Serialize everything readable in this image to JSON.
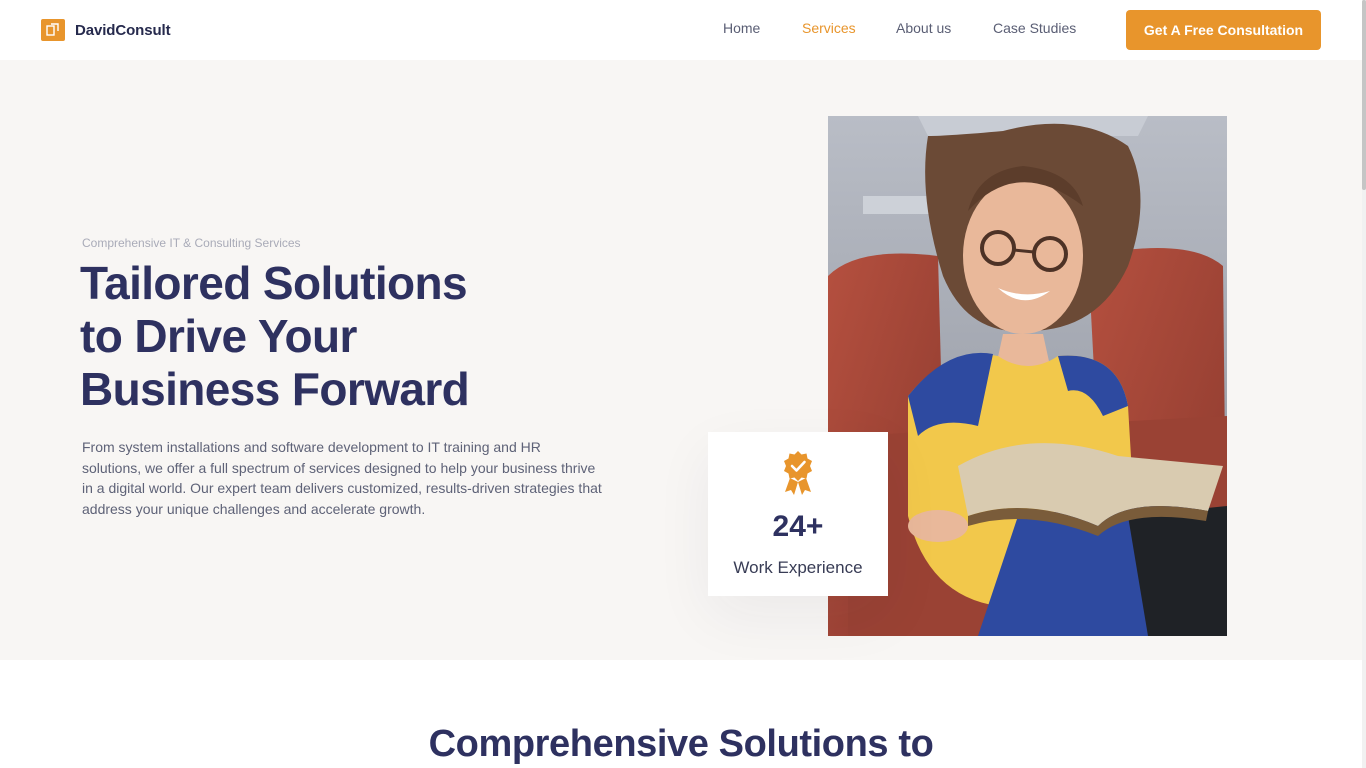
{
  "header": {
    "brand": "DavidConsult",
    "nav": [
      {
        "label": "Home",
        "active": false
      },
      {
        "label": "Services",
        "active": true
      },
      {
        "label": "About us",
        "active": false
      },
      {
        "label": "Case Studies",
        "active": false
      }
    ],
    "cta_label": "Get A Free Consultation"
  },
  "hero": {
    "eyebrow": "Comprehensive IT & Consulting Services",
    "title_lines": [
      "Tailored Solutions",
      "to Drive Your",
      "Business Forward"
    ],
    "description": "From system installations and software development to IT training and HR solutions, we offer a full spectrum of services designed to help your business thrive in a digital world. Our expert team delivers customized, results-driven strategies that address your unique challenges and accelerate growth.",
    "stat": {
      "value": "24+",
      "label": "Work Experience",
      "icon": "award-badge-icon"
    }
  },
  "section": {
    "title": "Comprehensive Solutions to"
  },
  "colors": {
    "accent": "#e8952c",
    "navy": "#2e3160",
    "hero_bg": "#f8f6f4"
  }
}
